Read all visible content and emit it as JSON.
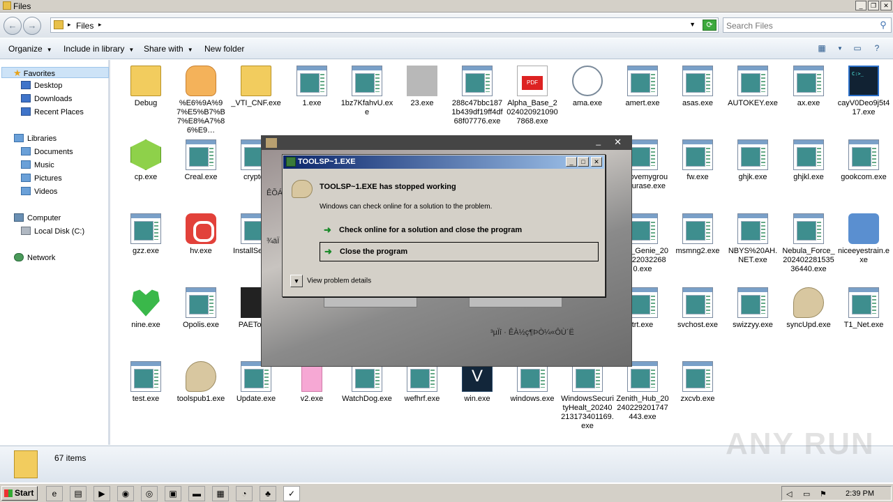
{
  "window": {
    "title": "Files",
    "minimize_label": "_",
    "maximize_label": "❐",
    "close_label": "✕"
  },
  "address": {
    "path": "Files",
    "search_placeholder": "Search Files",
    "back_label": "←",
    "forward_label": "→"
  },
  "toolbar": {
    "organize": "Organize",
    "include_in_library": "Include in library",
    "share_with": "Share with",
    "new_folder": "New folder"
  },
  "nav": {
    "favorites": "Favorites",
    "desktop": "Desktop",
    "downloads": "Downloads",
    "recent_places": "Recent Places",
    "libraries": "Libraries",
    "documents": "Documents",
    "music": "Music",
    "pictures": "Pictures",
    "videos": "Videos",
    "computer": "Computer",
    "local_disk": "Local Disk (C:)",
    "network": "Network"
  },
  "files": [
    {
      "name": "Debug",
      "icon": "folder-icon"
    },
    {
      "name": "%E6%9A%97%E5%B7%B7%E8%A7%86%E9…",
      "icon": "cat-icon"
    },
    {
      "name": "_VTI_CNF.exe",
      "icon": "folder-icon"
    },
    {
      "name": "1.exe",
      "icon": "exe-icon"
    },
    {
      "name": "1bz7KfahvU.exe",
      "icon": "exe-icon"
    },
    {
      "name": "23.exe",
      "icon": "blurred-icon"
    },
    {
      "name": "288c47bbc1871b439df19ff4df68f07776.exe",
      "icon": "exe-icon"
    },
    {
      "name": "Alpha_Base_20240209210907868.exe",
      "icon": "pdf-icon"
    },
    {
      "name": "ama.exe",
      "icon": "gauge-icon"
    },
    {
      "name": "amert.exe",
      "icon": "exe-icon"
    },
    {
      "name": "asas.exe",
      "icon": "exe-icon"
    },
    {
      "name": "AUTOKEY.exe",
      "icon": "exe-icon"
    },
    {
      "name": "ax.exe",
      "icon": "exe-icon"
    },
    {
      "name": "cayV0Deo9j5t417.exe",
      "icon": "terminal-icon"
    },
    {
      "name": "cp.exe",
      "icon": "cube-icon"
    },
    {
      "name": "Creal.exe",
      "icon": "exe-icon"
    },
    {
      "name": "crypted",
      "icon": "exe-icon"
    },
    {
      "name": "_shovemygroupyourase.exe",
      "icon": "exe-icon"
    },
    {
      "name": "fw.exe",
      "icon": "exe-icon"
    },
    {
      "name": "ghjk.exe",
      "icon": "exe-icon"
    },
    {
      "name": "ghjkl.exe",
      "icon": "exe-icon"
    },
    {
      "name": "gookcom.exe",
      "icon": "exe-icon"
    },
    {
      "name": "gzz.exe",
      "icon": "exe-icon"
    },
    {
      "name": "hv.exe",
      "icon": "record-icon"
    },
    {
      "name": "InstallSe .exe",
      "icon": "exe-icon"
    },
    {
      "name": "acle_Genie_20240220322680.exe",
      "icon": "exe-icon"
    },
    {
      "name": "msmng2.exe",
      "icon": "exe-icon"
    },
    {
      "name": "NBYS%20AH.NET.exe",
      "icon": "exe-icon"
    },
    {
      "name": "Nebula_Force_20240228153536440.exe",
      "icon": "exe-icon"
    },
    {
      "name": "niceeyestrain.exe",
      "icon": "user-icon"
    },
    {
      "name": "nine.exe",
      "icon": "heart-icon"
    },
    {
      "name": "Opolis.exe",
      "icon": "exe-icon"
    },
    {
      "name": "PAETool e",
      "icon": "chip-icon"
    },
    {
      "name": "trt.exe",
      "icon": "exe-icon"
    },
    {
      "name": "svchost.exe",
      "icon": "exe-icon"
    },
    {
      "name": "swizzyy.exe",
      "icon": "exe-icon"
    },
    {
      "name": "syncUpd.exe",
      "icon": "bubble-icon"
    },
    {
      "name": "T1_Net.exe",
      "icon": "exe-icon"
    },
    {
      "name": "test.exe",
      "icon": "exe-icon"
    },
    {
      "name": "toolspub1.exe",
      "icon": "bubble-icon"
    },
    {
      "name": "Update.exe",
      "icon": "exe-icon"
    },
    {
      "name": "v2.exe",
      "icon": "pink-icon"
    },
    {
      "name": "WatchDog.exe",
      "icon": "exe-icon"
    },
    {
      "name": "wefhrf.exe",
      "icon": "exe-icon"
    },
    {
      "name": "win.exe",
      "icon": "v-icon"
    },
    {
      "name": "windows.exe",
      "icon": "exe-icon"
    },
    {
      "name": "WindowsSecurityHealt_20240213173401169.exe",
      "icon": "exe-icon"
    },
    {
      "name": "Zenith_Hub_20240229201747443.exe",
      "icon": "exe-icon"
    },
    {
      "name": "zxcvb.exe",
      "icon": "exe-icon"
    }
  ],
  "status": {
    "count": "67 items"
  },
  "bgwindow": {
    "text1": "ÊÕÁ",
    "text2": "¾äÏ",
    "text3": "³µÏî · ÊÀ½ç¶ÞÒ¼«ÔÙ´Ë",
    "minimize_label": "_",
    "close_label": "✕"
  },
  "dialog": {
    "title": "TOOLSP~1.EXE",
    "heading": "TOOLSP~1.EXE has stopped working",
    "sub": "Windows can check online for a solution to the problem.",
    "option1": "Check online for a solution and close the program",
    "option2": "Close the program",
    "details": "View problem details",
    "min_label": "_",
    "max_label": "□",
    "close_label": "✕"
  },
  "taskbar": {
    "start": "Start",
    "clock": "2:39 PM"
  },
  "watermark": "ANY RUN"
}
